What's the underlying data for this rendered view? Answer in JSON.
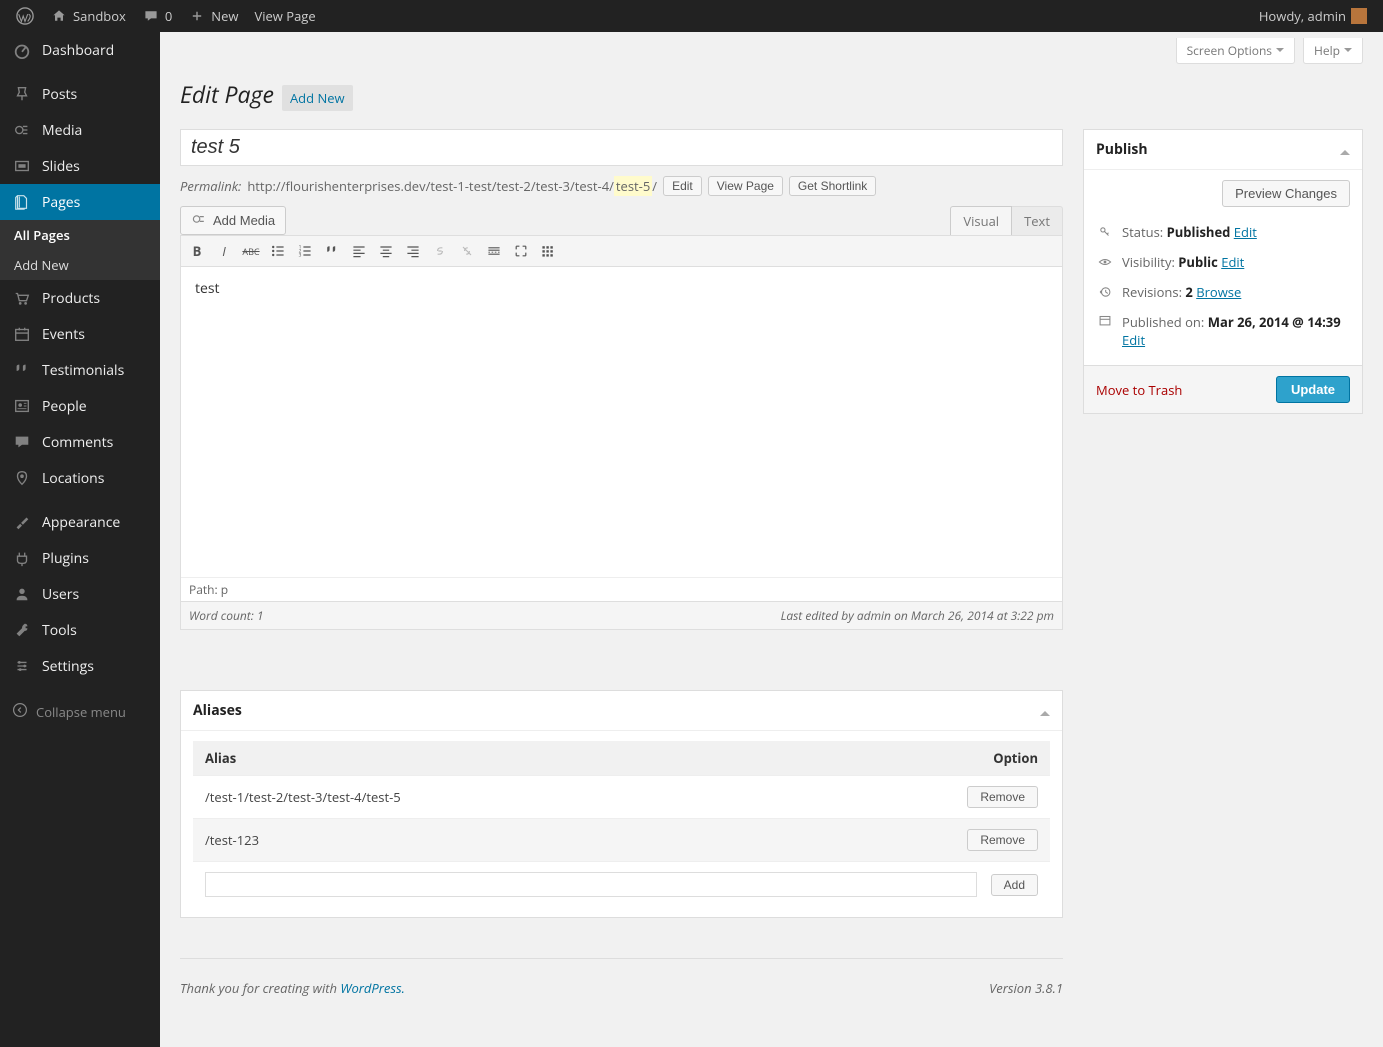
{
  "adminbar": {
    "site_name": "Sandbox",
    "comments_count": "0",
    "new_label": "New",
    "view_page": "View Page",
    "howdy": "Howdy, admin"
  },
  "sidebar": {
    "items": [
      {
        "label": "Dashboard",
        "icon": "dashboard"
      },
      {
        "label": "Posts",
        "icon": "pin"
      },
      {
        "label": "Media",
        "icon": "media"
      },
      {
        "label": "Slides",
        "icon": "slides"
      },
      {
        "label": "Pages",
        "icon": "pages",
        "active": true,
        "submenu": [
          {
            "label": "All Pages",
            "current": true
          },
          {
            "label": "Add New"
          }
        ]
      },
      {
        "label": "Products",
        "icon": "cart"
      },
      {
        "label": "Events",
        "icon": "calendar"
      },
      {
        "label": "Testimonials",
        "icon": "quote"
      },
      {
        "label": "People",
        "icon": "people"
      },
      {
        "label": "Comments",
        "icon": "comment"
      },
      {
        "label": "Locations",
        "icon": "location"
      },
      {
        "label": "Appearance",
        "icon": "appearance"
      },
      {
        "label": "Plugins",
        "icon": "plugin"
      },
      {
        "label": "Users",
        "icon": "user"
      },
      {
        "label": "Tools",
        "icon": "tools"
      },
      {
        "label": "Settings",
        "icon": "settings"
      }
    ],
    "collapse": "Collapse menu"
  },
  "top_tabs": {
    "screen_options": "Screen Options",
    "help": "Help"
  },
  "heading": {
    "title": "Edit Page",
    "add_new": "Add New"
  },
  "editor": {
    "title_value": "test 5",
    "permalink_label": "Permalink:",
    "permalink_base": "http://flourishenterprises.dev/test-1-test/test-2/test-3/test-4/",
    "permalink_slug": "test-5",
    "permalink_tail": "/",
    "edit_btn": "Edit",
    "view_page_btn": "View Page",
    "shortlink_btn": "Get Shortlink",
    "add_media": "Add Media",
    "tab_visual": "Visual",
    "tab_text": "Text",
    "body_text": "test",
    "path_label": "Path: p",
    "word_count": "Word count: 1",
    "last_edited": "Last edited by admin on March 26, 2014 at 3:22 pm"
  },
  "publish": {
    "title": "Publish",
    "preview": "Preview Changes",
    "status_label": "Status:",
    "status_value": "Published",
    "status_edit": "Edit",
    "visibility_label": "Visibility:",
    "visibility_value": "Public",
    "visibility_edit": "Edit",
    "revisions_label": "Revisions:",
    "revisions_value": "2",
    "revisions_browse": "Browse",
    "published_label": "Published on:",
    "published_value": "Mar 26, 2014 @ 14:39",
    "published_edit": "Edit",
    "trash": "Move to Trash",
    "update": "Update"
  },
  "aliases": {
    "title": "Aliases",
    "col_alias": "Alias",
    "col_option": "Option",
    "rows": [
      {
        "path": "/test-1/test-2/test-3/test-4/test-5",
        "btn": "Remove"
      },
      {
        "path": "/test-123",
        "btn": "Remove"
      }
    ],
    "add_btn": "Add"
  },
  "footer": {
    "thankyou_pre": "Thank you for creating with ",
    "thankyou_link": "WordPress.",
    "version": "Version 3.8.1"
  }
}
